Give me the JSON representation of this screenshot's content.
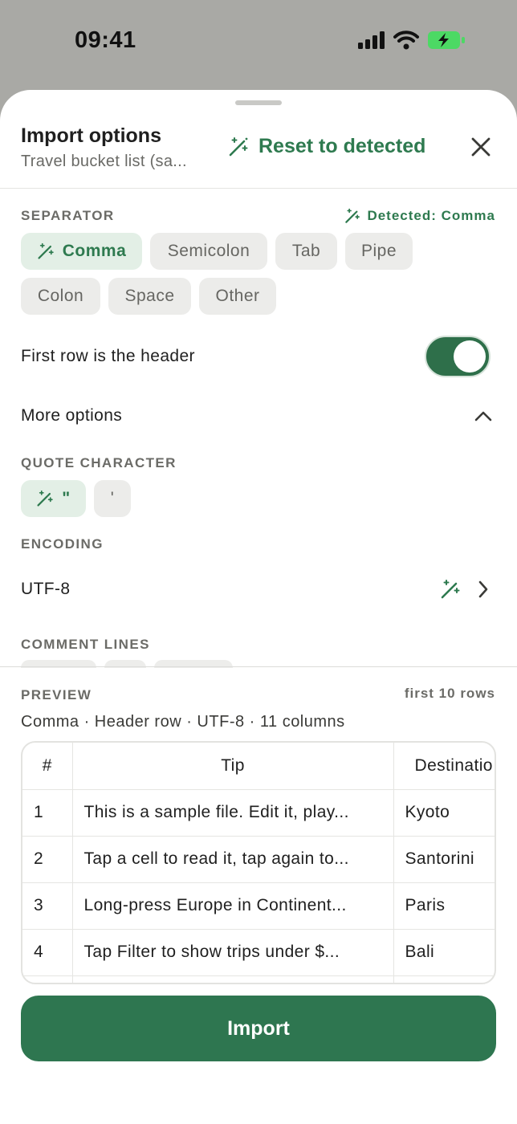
{
  "status_bar": {
    "time": "09:41"
  },
  "header": {
    "title": "Import options",
    "subtitle": "Travel bucket list (sa...",
    "reset_label": "Reset to detected"
  },
  "separator": {
    "label": "SEPARATOR",
    "detected": "Detected: Comma",
    "options": [
      "Comma",
      "Semicolon",
      "Tab",
      "Pipe",
      "Colon",
      "Space",
      "Other"
    ],
    "selected": "Comma"
  },
  "header_toggle": {
    "label": "First row is the header",
    "on": true
  },
  "more_options": {
    "label": "More options",
    "expanded": true
  },
  "quote": {
    "label": "QUOTE CHARACTER",
    "options": [
      "\"",
      "'"
    ],
    "selected": "\""
  },
  "encoding": {
    "label": "ENCODING",
    "value": "UTF-8"
  },
  "comment_lines": {
    "label": "COMMENT LINES"
  },
  "preview": {
    "label": "PREVIEW",
    "meta": "first 10 rows",
    "summary": "Comma · Header row · UTF-8 · 11 columns",
    "columns": [
      "#",
      "Tip",
      "Destinatio"
    ],
    "rows": [
      [
        "1",
        "This is a sample file. Edit it, play...",
        "Kyoto"
      ],
      [
        "2",
        "Tap a cell to read it, tap again to...",
        "Santorini"
      ],
      [
        "3",
        "Long-press Europe in Continent...",
        "Paris"
      ],
      [
        "4",
        "Tap Filter to show trips under $...",
        "Bali"
      ],
      [
        "",
        "",
        ""
      ]
    ]
  },
  "import_button": {
    "label": "Import"
  },
  "colors": {
    "accent": "#2e7a4f",
    "button": "#2e7650",
    "chip_bg": "#ececea",
    "chip_active_bg": "#e3efe6"
  }
}
